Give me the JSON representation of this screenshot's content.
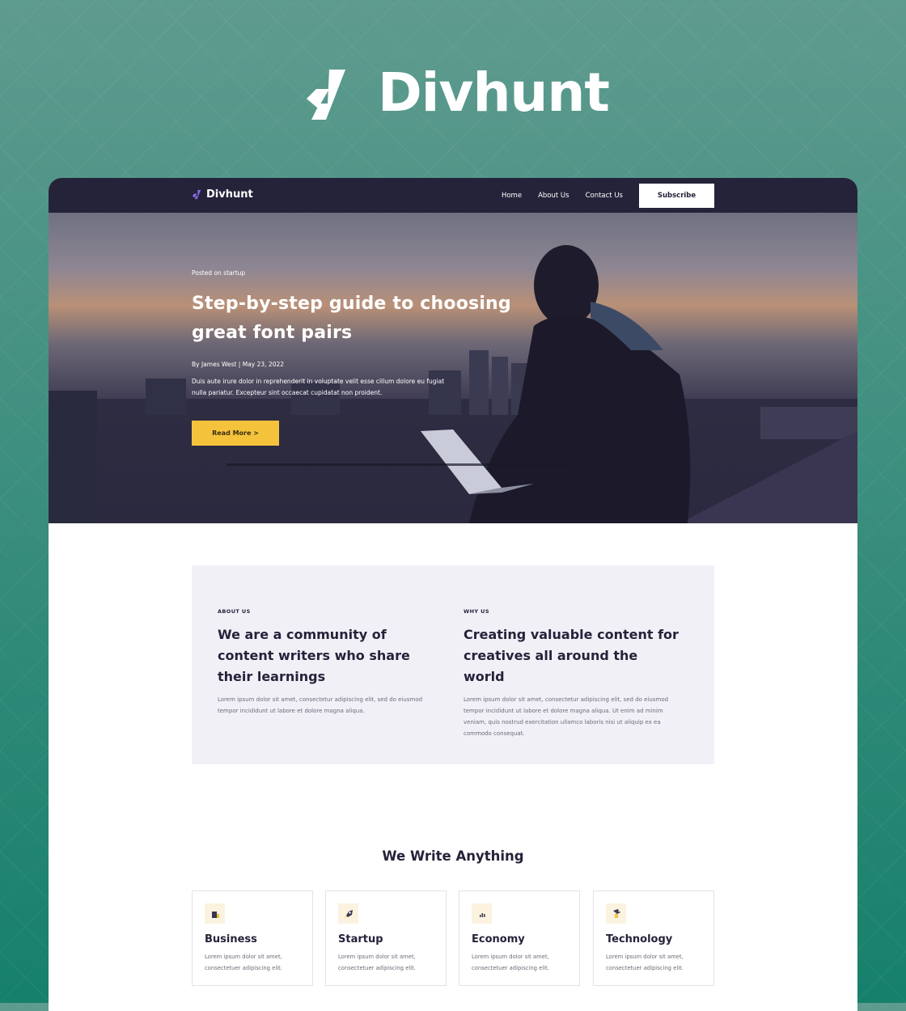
{
  "brand": {
    "name": "Divhunt"
  },
  "nav": {
    "logo": "Divhunt",
    "links": [
      "Home",
      "About Us",
      "Contact Us"
    ],
    "subscribe": "Subscribe"
  },
  "hero": {
    "eyebrow": "Posted on startup",
    "title": "Step-by-step guide to choosing great font pairs",
    "meta": "By James West  |  May 23, 2022",
    "description": "Duis aute irure dolor in reprehenderit in voluptate velit esse cillum dolore eu fugiat nulla pariatur. Excepteur sint occaecat cupidatat non proident.",
    "button": "Read More >"
  },
  "about": {
    "left": {
      "eyebrow": "ABOUT US",
      "title": "We are a community of content writers who share their learnings",
      "text": "Lorem ipsum dolor sit amet, consectetur adipiscing elit, sed do eiusmod tempor incididunt ut labore et dolore magna aliqua."
    },
    "right": {
      "eyebrow": "WHY US",
      "title": "Creating valuable content for creatives all around the world",
      "text": "Lorem ipsum dolor sit amet, consectetur adipiscing elit, sed do eiusmod tempor incididunt ut labore et dolore magna aliqua. Ut enim ad minim veniam, quis nostrud exercitation ullamco laboris nisi ut aliquip ex ea commodo consequat."
    }
  },
  "categories": {
    "title": "We Write Anything",
    "items": [
      {
        "title": "Business",
        "text": "Lorem ipsum dolor sit amet, consectetuer adipiscing elit.",
        "icon": "business-icon"
      },
      {
        "title": "Startup",
        "text": "Lorem ipsum dolor sit amet, consectetuer adipiscing elit.",
        "icon": "rocket-icon"
      },
      {
        "title": "Economy",
        "text": "Lorem ipsum dolor sit amet, consectetuer adipiscing elit.",
        "icon": "chart-icon"
      },
      {
        "title": "Technology",
        "text": "Lorem ipsum dolor sit amet, consectetuer adipiscing elit.",
        "icon": "robot-icon"
      }
    ]
  },
  "colors": {
    "nav_bg": "#25233a",
    "accent_yellow": "#f5c33b",
    "panel_bg": "#f2f0f7",
    "logo_purple": "#8b6cf0"
  }
}
